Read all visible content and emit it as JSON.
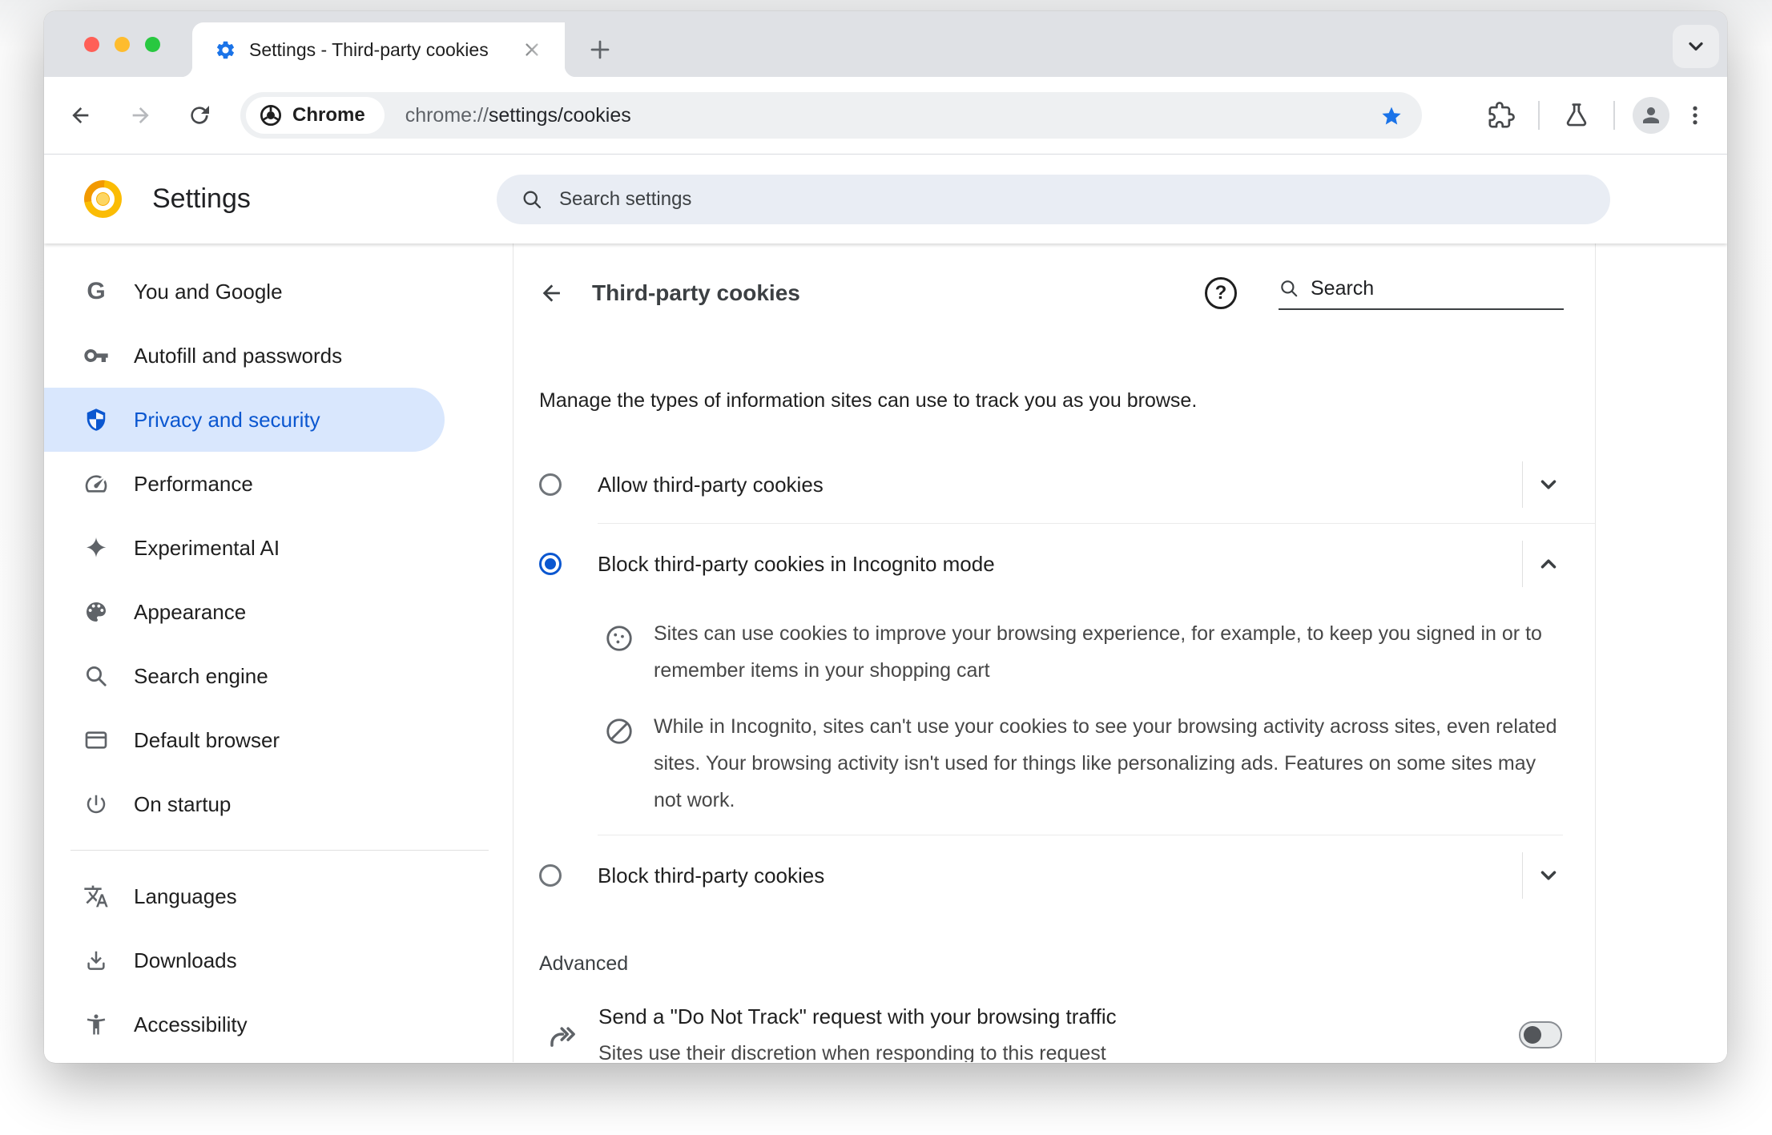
{
  "colors": {
    "accent_blue": "#0B57D0",
    "star_blue": "#1A73E8",
    "selected_item_bg": "#D9E7FD",
    "canary_yellow": "#FBBC04"
  },
  "browser": {
    "tab_title": "Settings - Third-party cookies",
    "site_chip_label": "Chrome",
    "url_scheme": "chrome://",
    "url_path": "settings/cookies"
  },
  "settings_header": {
    "title": "Settings",
    "search_placeholder": "Search settings"
  },
  "sidebar": {
    "items": [
      {
        "label": "You and Google",
        "icon": "google-g-icon",
        "glyph": "G"
      },
      {
        "label": "Autofill and passwords",
        "icon": "key-icon"
      },
      {
        "label": "Privacy and security",
        "icon": "shield-icon",
        "selected": true
      },
      {
        "label": "Performance",
        "icon": "speedometer-icon"
      },
      {
        "label": "Experimental AI",
        "icon": "sparkle-icon"
      },
      {
        "label": "Appearance",
        "icon": "palette-icon"
      },
      {
        "label": "Search engine",
        "icon": "magnifier-icon"
      },
      {
        "label": "Default browser",
        "icon": "browser-window-icon"
      },
      {
        "label": "On startup",
        "icon": "power-icon"
      },
      {
        "label": "Languages",
        "icon": "translate-icon"
      },
      {
        "label": "Downloads",
        "icon": "download-icon"
      },
      {
        "label": "Accessibility",
        "icon": "accessibility-icon"
      }
    ]
  },
  "page": {
    "title": "Third-party cookies",
    "search_placeholder": "Search",
    "intro": "Manage the types of information sites can use to track you as you browse.",
    "options": [
      {
        "label": "Allow third-party cookies",
        "selected": false,
        "expanded": false
      },
      {
        "label": "Block third-party cookies in Incognito mode",
        "selected": true,
        "expanded": true
      },
      {
        "label": "Block third-party cookies",
        "selected": false,
        "expanded": false
      }
    ],
    "incognito_details": [
      {
        "icon": "cookie-icon",
        "text": "Sites can use cookies to improve your browsing experience, for example, to keep you signed in or to remember items in your shopping cart"
      },
      {
        "icon": "blocked-icon",
        "text": "While in Incognito, sites can't use your cookies to see your browsing activity across sites, even related sites. Your browsing activity isn't used for things like personalizing ads. Features on some sites may not work."
      }
    ],
    "advanced_label": "Advanced",
    "do_not_track": {
      "title": "Send a \"Do Not Track\" request with your browsing traffic",
      "subtitle": "Sites use their discretion when responding to this request",
      "enabled": false
    }
  }
}
